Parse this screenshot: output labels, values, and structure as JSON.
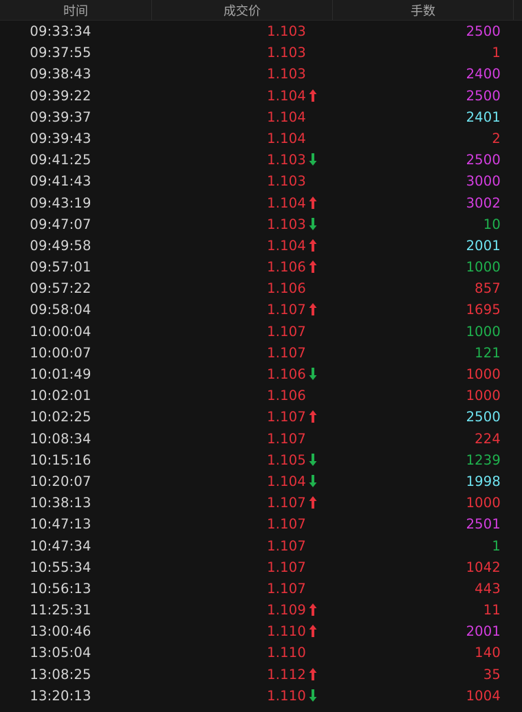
{
  "header": {
    "time": "时间",
    "price": "成交价",
    "volume": "手数"
  },
  "colors": {
    "red": "#e8323c",
    "green": "#1fb24e",
    "magenta": "#d43ee0",
    "cyan": "#6fe3f0",
    "background": "#141414"
  },
  "trades": [
    {
      "time": "09:33:34",
      "price": "1.103",
      "arrow": "",
      "volume": "2500",
      "vol_color": "magenta"
    },
    {
      "time": "09:37:55",
      "price": "1.103",
      "arrow": "",
      "volume": "1",
      "vol_color": "red"
    },
    {
      "time": "09:38:43",
      "price": "1.103",
      "arrow": "",
      "volume": "2400",
      "vol_color": "magenta"
    },
    {
      "time": "09:39:22",
      "price": "1.104",
      "arrow": "up",
      "volume": "2500",
      "vol_color": "magenta"
    },
    {
      "time": "09:39:37",
      "price": "1.104",
      "arrow": "",
      "volume": "2401",
      "vol_color": "cyan"
    },
    {
      "time": "09:39:43",
      "price": "1.104",
      "arrow": "",
      "volume": "2",
      "vol_color": "red"
    },
    {
      "time": "09:41:25",
      "price": "1.103",
      "arrow": "down",
      "volume": "2500",
      "vol_color": "magenta"
    },
    {
      "time": "09:41:43",
      "price": "1.103",
      "arrow": "",
      "volume": "3000",
      "vol_color": "magenta"
    },
    {
      "time": "09:43:19",
      "price": "1.104",
      "arrow": "up",
      "volume": "3002",
      "vol_color": "magenta"
    },
    {
      "time": "09:47:07",
      "price": "1.103",
      "arrow": "down",
      "volume": "10",
      "vol_color": "green"
    },
    {
      "time": "09:49:58",
      "price": "1.104",
      "arrow": "up",
      "volume": "2001",
      "vol_color": "cyan"
    },
    {
      "time": "09:57:01",
      "price": "1.106",
      "arrow": "up",
      "volume": "1000",
      "vol_color": "green"
    },
    {
      "time": "09:57:22",
      "price": "1.106",
      "arrow": "",
      "volume": "857",
      "vol_color": "red"
    },
    {
      "time": "09:58:04",
      "price": "1.107",
      "arrow": "up",
      "volume": "1695",
      "vol_color": "red"
    },
    {
      "time": "10:00:04",
      "price": "1.107",
      "arrow": "",
      "volume": "1000",
      "vol_color": "green"
    },
    {
      "time": "10:00:07",
      "price": "1.107",
      "arrow": "",
      "volume": "121",
      "vol_color": "green"
    },
    {
      "time": "10:01:49",
      "price": "1.106",
      "arrow": "down",
      "volume": "1000",
      "vol_color": "red"
    },
    {
      "time": "10:02:01",
      "price": "1.106",
      "arrow": "",
      "volume": "1000",
      "vol_color": "red"
    },
    {
      "time": "10:02:25",
      "price": "1.107",
      "arrow": "up",
      "volume": "2500",
      "vol_color": "cyan"
    },
    {
      "time": "10:08:34",
      "price": "1.107",
      "arrow": "",
      "volume": "224",
      "vol_color": "red"
    },
    {
      "time": "10:15:16",
      "price": "1.105",
      "arrow": "down",
      "volume": "1239",
      "vol_color": "green"
    },
    {
      "time": "10:20:07",
      "price": "1.104",
      "arrow": "down",
      "volume": "1998",
      "vol_color": "cyan"
    },
    {
      "time": "10:38:13",
      "price": "1.107",
      "arrow": "up",
      "volume": "1000",
      "vol_color": "red"
    },
    {
      "time": "10:47:13",
      "price": "1.107",
      "arrow": "",
      "volume": "2501",
      "vol_color": "magenta"
    },
    {
      "time": "10:47:34",
      "price": "1.107",
      "arrow": "",
      "volume": "1",
      "vol_color": "green"
    },
    {
      "time": "10:55:34",
      "price": "1.107",
      "arrow": "",
      "volume": "1042",
      "vol_color": "red"
    },
    {
      "time": "10:56:13",
      "price": "1.107",
      "arrow": "",
      "volume": "443",
      "vol_color": "red"
    },
    {
      "time": "11:25:31",
      "price": "1.109",
      "arrow": "up",
      "volume": "11",
      "vol_color": "red"
    },
    {
      "time": "13:00:46",
      "price": "1.110",
      "arrow": "up",
      "volume": "2001",
      "vol_color": "magenta"
    },
    {
      "time": "13:05:04",
      "price": "1.110",
      "arrow": "",
      "volume": "140",
      "vol_color": "red"
    },
    {
      "time": "13:08:25",
      "price": "1.112",
      "arrow": "up",
      "volume": "35",
      "vol_color": "red"
    },
    {
      "time": "13:20:13",
      "price": "1.110",
      "arrow": "down",
      "volume": "1004",
      "vol_color": "red"
    }
  ]
}
